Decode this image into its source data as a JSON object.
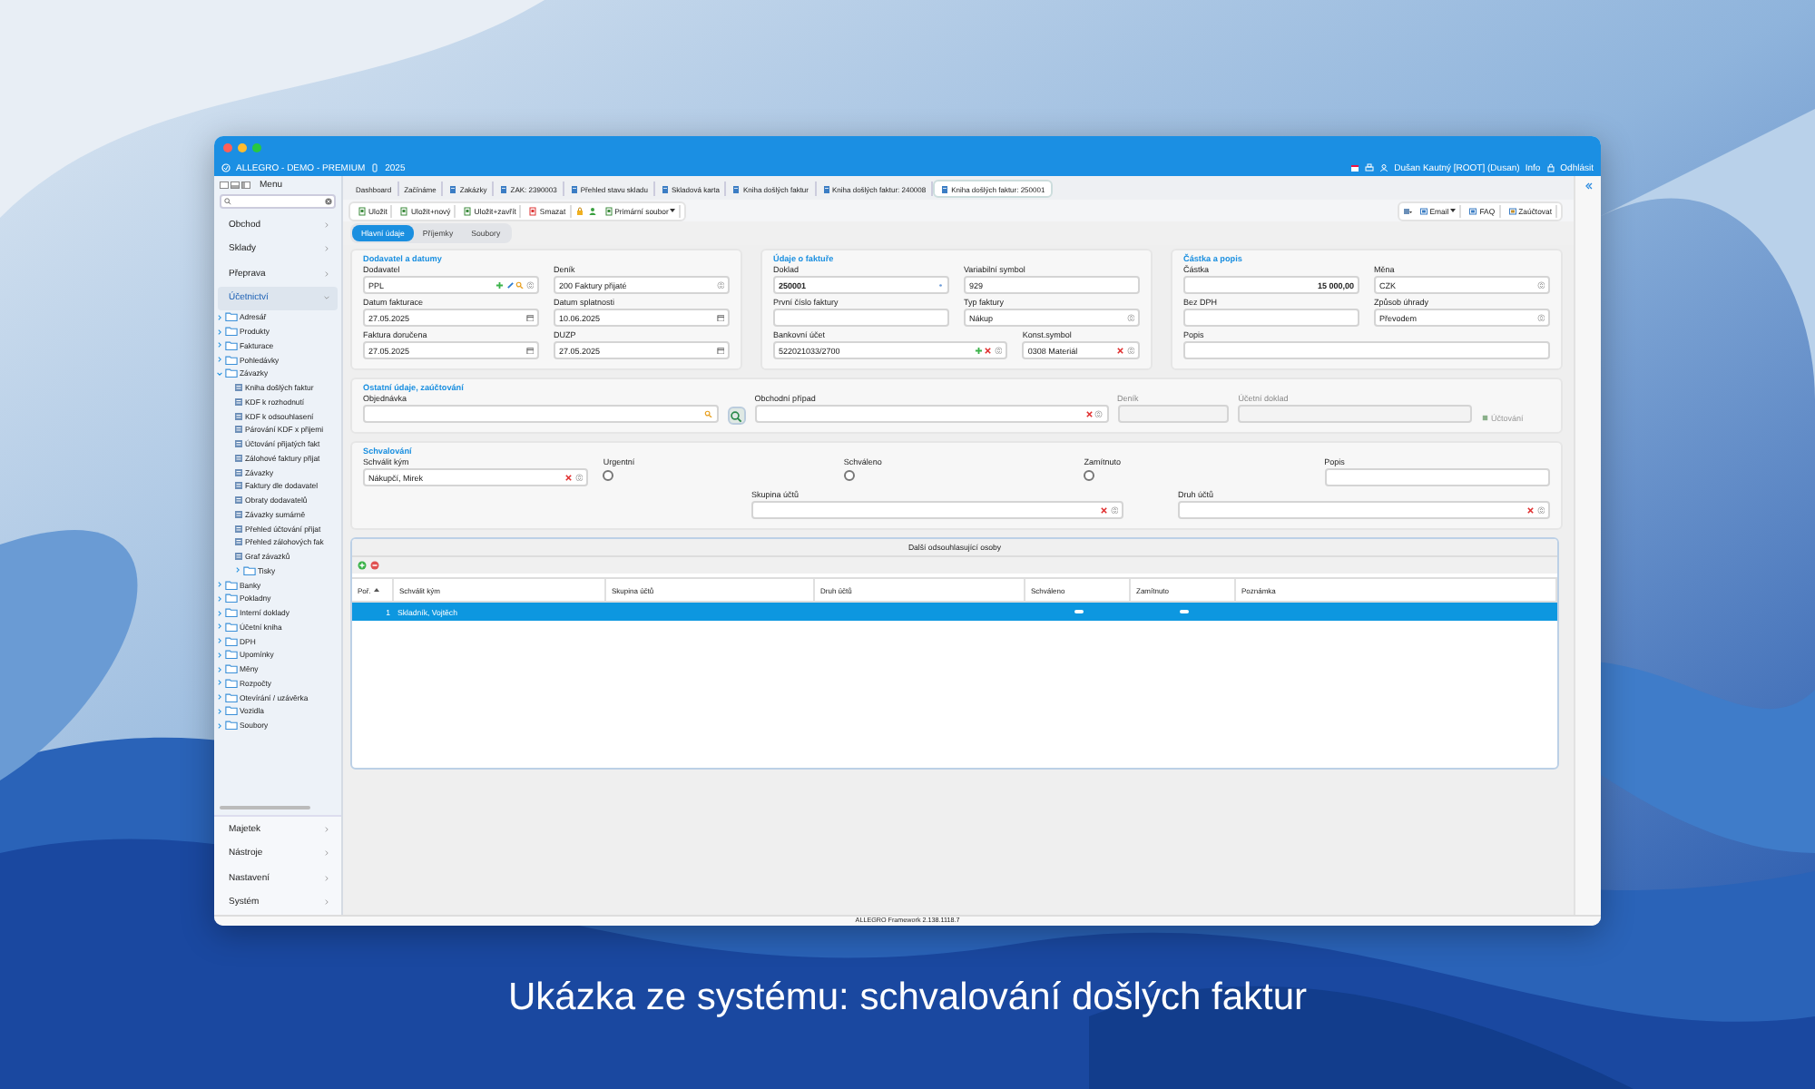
{
  "app_bar": {
    "app": "ALLEGRO - DEMO - PREMIUM",
    "year": "2025",
    "user": "Dušan Kautný [ROOT] (Dusan)",
    "info": "Info",
    "logout": "Odhlásit"
  },
  "sidebar": {
    "title": "Menu",
    "sections": [
      {
        "label": "Obchod",
        "selected": false,
        "expanded": false
      },
      {
        "label": "Sklady",
        "selected": false,
        "expanded": false
      },
      {
        "label": "Přeprava",
        "selected": false,
        "expanded": false
      },
      {
        "label": "Účetnictví",
        "selected": true,
        "expanded": true,
        "children": [
          {
            "label": "Adresář",
            "kind": "folder",
            "expanded": false
          },
          {
            "label": "Produkty",
            "kind": "folder",
            "expanded": false
          },
          {
            "label": "Fakturace",
            "kind": "folder",
            "expanded": false
          },
          {
            "label": "Pohledávky",
            "kind": "folder",
            "expanded": false
          },
          {
            "label": "Závazky",
            "kind": "folder",
            "expanded": true,
            "children": [
              {
                "label": "Kniha došlých faktur",
                "kind": "report"
              },
              {
                "label": "KDF k rozhodnutí",
                "kind": "report"
              },
              {
                "label": "KDF k odsouhlasení",
                "kind": "report"
              },
              {
                "label": "Párování KDF x přijemi",
                "kind": "report"
              },
              {
                "label": "Účtování přijatých fakt",
                "kind": "report"
              },
              {
                "label": "Zálohové faktury přijat",
                "kind": "report"
              },
              {
                "label": "Závazky",
                "kind": "report"
              },
              {
                "label": "Faktury dle dodavatel",
                "kind": "report"
              },
              {
                "label": "Obraty dodavatelů",
                "kind": "report"
              },
              {
                "label": "Závazky sumárně",
                "kind": "report"
              },
              {
                "label": "Přehled účtování přijat",
                "kind": "report"
              },
              {
                "label": "Přehled zálohových fak",
                "kind": "report"
              },
              {
                "label": "Graf závazků",
                "kind": "report"
              },
              {
                "label": "Tisky",
                "kind": "folder",
                "expanded": false
              }
            ]
          },
          {
            "label": "Banky",
            "kind": "folder",
            "expanded": false
          },
          {
            "label": "Pokladny",
            "kind": "folder",
            "expanded": false
          },
          {
            "label": "Interní doklady",
            "kind": "folder",
            "expanded": false
          },
          {
            "label": "Účetní kniha",
            "kind": "folder",
            "expanded": false
          },
          {
            "label": "DPH",
            "kind": "folder",
            "expanded": false
          },
          {
            "label": "Upomínky",
            "kind": "folder",
            "expanded": false
          },
          {
            "label": "Měny",
            "kind": "folder",
            "expanded": false
          },
          {
            "label": "Rozpočty",
            "kind": "folder",
            "expanded": false
          },
          {
            "label": "Otevírání / uzávěrka",
            "kind": "folder",
            "expanded": false
          },
          {
            "label": "Vozidla",
            "kind": "folder",
            "expanded": false
          },
          {
            "label": "Soubory",
            "kind": "folder",
            "expanded": false
          }
        ]
      }
    ],
    "bottom_sections": [
      {
        "label": "Majetek",
        "selected": false,
        "expanded": false
      },
      {
        "label": "Nástroje",
        "selected": false,
        "expanded": false
      },
      {
        "label": "Nastavení",
        "selected": false,
        "expanded": false
      },
      {
        "label": "Systém",
        "selected": false,
        "expanded": false
      }
    ]
  },
  "tabs": [
    {
      "label": "Dashboard",
      "kind": "text",
      "selected": false
    },
    {
      "label": "Začínáme",
      "kind": "text",
      "selected": false
    },
    {
      "label": "Zakázky",
      "kind": "doc",
      "selected": false
    },
    {
      "label": "ZAK: 2390003",
      "kind": "doc",
      "selected": false
    },
    {
      "label": "Přehled stavu skladu",
      "kind": "doc",
      "selected": false
    },
    {
      "label": "Skladová karta",
      "kind": "doc",
      "selected": false
    },
    {
      "label": "Kniha došlých faktur",
      "kind": "doc",
      "selected": false
    },
    {
      "label": "Kniha došlých faktur: 240008",
      "kind": "doc",
      "selected": false
    },
    {
      "label": "Kniha došlých faktur: 250001",
      "kind": "doc",
      "selected": true
    }
  ],
  "toolbar": {
    "left": [
      {
        "label": "Uložit",
        "kind": "button"
      },
      {
        "label": "Uložit+nový",
        "kind": "button"
      },
      {
        "label": "Uložit+zavřít",
        "kind": "button"
      },
      {
        "label": "Smazat",
        "kind": "button"
      },
      {
        "label": "Primární soubor",
        "kind": "menu"
      }
    ],
    "right": [
      {
        "label": "Email",
        "kind": "menu"
      },
      {
        "label": "FAQ",
        "kind": "button"
      },
      {
        "label": "Zaúčtovat",
        "kind": "button"
      }
    ]
  },
  "subtabs": [
    {
      "label": "Hlavní údaje",
      "selected": true
    },
    {
      "label": "Příjemky",
      "selected": false
    },
    {
      "label": "Soubory",
      "selected": false
    }
  ],
  "form": {
    "sections": [
      {
        "title": "Dodavatel a datumy",
        "rows": [
          [
            {
              "label": "Dodavatel",
              "value": "PPL",
              "kind": "lookup-edit"
            },
            {
              "label": "Deník",
              "value": "200 Faktury přijaté",
              "kind": "select"
            }
          ],
          [
            {
              "label": "Datum fakturace",
              "value": "27.05.2025",
              "kind": "date"
            },
            {
              "label": "Datum splatnosti",
              "value": "10.06.2025",
              "kind": "date"
            }
          ],
          [
            {
              "label": "Faktura doručena",
              "value": "27.05.2025",
              "kind": "date"
            },
            {
              "label": "DUZP",
              "value": "27.05.2025",
              "kind": "date"
            }
          ]
        ]
      },
      {
        "title": "Údaje o faktuře",
        "rows": [
          [
            {
              "label": "Doklad",
              "value": "250001",
              "kind": "number"
            },
            {
              "label": "Variabilní symbol",
              "value": "929",
              "kind": "text"
            }
          ],
          [
            {
              "label": "První číslo faktury",
              "kind": "text"
            },
            {
              "label": "Typ faktury",
              "value": "Nákup",
              "kind": "select"
            }
          ],
          [
            {
              "label": "Bankovní účet",
              "value": "522021033/2700",
              "kind": "lookup-add"
            },
            {
              "label": "Konst.symbol",
              "value": "0308 Materiál",
              "kind": "lookup"
            }
          ]
        ]
      },
      {
        "title": "Částka a popis",
        "rows": [
          [
            {
              "label": "Částka",
              "value": "15 000,00",
              "kind": "amount"
            },
            {
              "label": "Měna",
              "value": "CZK",
              "kind": "select"
            }
          ],
          [
            {
              "label": "Bez DPH",
              "kind": "text"
            },
            {
              "label": "Způsob úhrady",
              "value": "Převodem",
              "kind": "select"
            }
          ],
          [
            {
              "label": "Popis",
              "kind": "text"
            }
          ]
        ]
      },
      {
        "title": "Ostatní údaje, zaúčtování",
        "rows": [
          [
            {
              "label": "Objednávka",
              "kind": "search"
            },
            {
              "kind": "search-button"
            },
            {
              "label": "Obchodní případ",
              "kind": "lookup"
            },
            {
              "label": "Deník",
              "kind": "readonly"
            },
            {
              "label": "Účetní doklad",
              "kind": "readonly"
            },
            {
              "label": "Účtování",
              "kind": "button"
            }
          ]
        ]
      },
      {
        "title": "Schvalování",
        "rows": [
          [
            {
              "label": "Schválit kým",
              "value": "Nákupčí, Mirek",
              "kind": "lookup"
            },
            {
              "label": "Urgentní",
              "kind": "radio",
              "checked": false
            },
            {
              "label": "Schváleno",
              "kind": "radio",
              "checked": false
            },
            {
              "label": "Zamítnuto",
              "kind": "radio",
              "checked": false
            },
            {
              "label": "Popis",
              "kind": "text"
            }
          ],
          [
            {
              "label": "Skupina účtů",
              "kind": "lookup"
            },
            {
              "label": "Druh účtů",
              "kind": "lookup"
            }
          ]
        ]
      }
    ]
  },
  "grid": {
    "title": "Další odsouhlasující osoby",
    "columns": [
      {
        "label": "Poř.",
        "sorted": true
      },
      {
        "label": "Schválit kým",
        "sorted": false
      },
      {
        "label": "Skupina účtů",
        "sorted": false
      },
      {
        "label": "Druh účtů",
        "sorted": false
      },
      {
        "label": "Schváleno",
        "sorted": false
      },
      {
        "label": "Zamítnuto",
        "sorted": false
      },
      {
        "label": "Poznámka",
        "sorted": false
      }
    ],
    "rows": [
      {
        "order": "1",
        "approver": "Skladník, Vojtěch",
        "approved": false,
        "rejected": false,
        "selected": true
      }
    ]
  },
  "status_bar": "ALLEGRO Framework 2.138.1118.7",
  "caption": "Ukázka ze systému: schvalování došlých faktur"
}
